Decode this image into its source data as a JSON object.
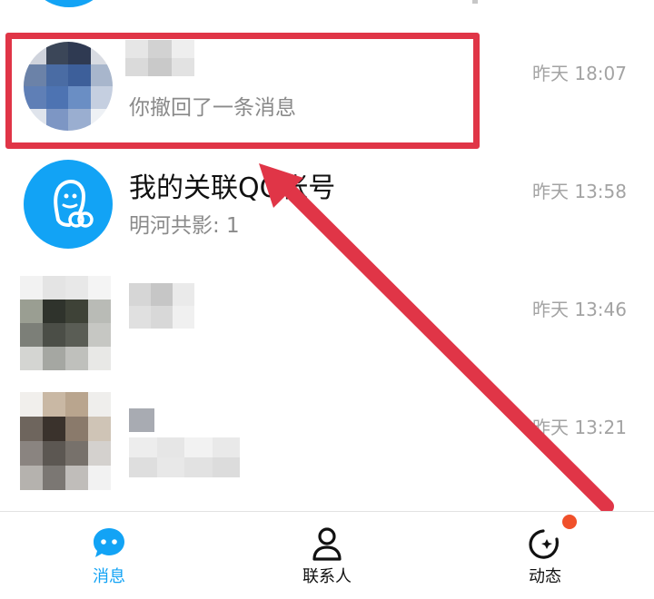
{
  "conversations": [
    {
      "name": "",
      "preview": "你撤回了一条消息",
      "time": "昨天 18:07"
    },
    {
      "name": "我的关联QQ帐号",
      "preview": "明河共影: 1",
      "time": "昨天 13:58"
    },
    {
      "name": "",
      "preview": "",
      "time": "昨天 13:46"
    },
    {
      "name": "",
      "preview": "",
      "time": "昨天 13:21"
    }
  ],
  "bottom_nav": {
    "messages": "消息",
    "contacts": "联系人",
    "moments": "动态"
  },
  "colors": {
    "accent": "#12a3f5",
    "highlight": "#e03547",
    "notification_dot": "#f0502a"
  },
  "icons": {
    "qq_account": "qq-ghost-icon",
    "messages": "chat-bubble-icon",
    "contacts": "person-icon",
    "moments": "star-orbit-icon"
  }
}
